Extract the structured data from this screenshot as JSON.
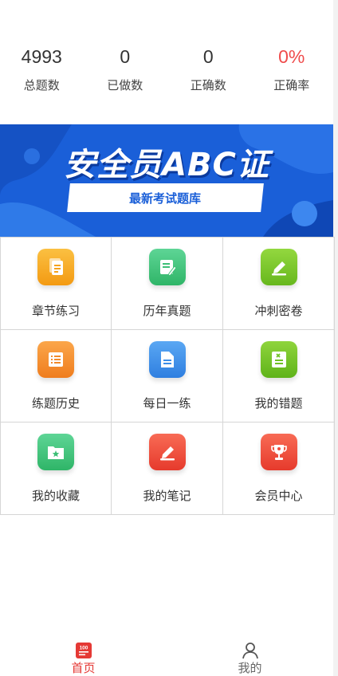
{
  "stats": [
    {
      "value": "4993",
      "label": "总题数"
    },
    {
      "value": "0",
      "label": "已做数"
    },
    {
      "value": "0",
      "label": "正确数"
    },
    {
      "value": "0%",
      "label": "正确率"
    }
  ],
  "banner": {
    "title": "安全员ABC证",
    "subtitle": "最新考试题库"
  },
  "menu": [
    {
      "label": "章节练习",
      "icon": "chapter-practice-icon",
      "color": "#f7a31c"
    },
    {
      "label": "历年真题",
      "icon": "past-exams-icon",
      "color": "#3fc07a"
    },
    {
      "label": "冲刺密卷",
      "icon": "sprint-paper-icon",
      "color": "#7cc52a"
    },
    {
      "label": "练题历史",
      "icon": "history-icon",
      "color": "#f58c2b"
    },
    {
      "label": "每日一练",
      "icon": "daily-practice-icon",
      "color": "#3b8de8"
    },
    {
      "label": "我的错题",
      "icon": "wrong-questions-icon",
      "color": "#6fc224"
    },
    {
      "label": "我的收藏",
      "icon": "favorites-icon",
      "color": "#3fbf76"
    },
    {
      "label": "我的笔记",
      "icon": "notes-icon",
      "color": "#ef4a3a"
    },
    {
      "label": "会员中心",
      "icon": "vip-center-icon",
      "color": "#ef4a3a"
    }
  ],
  "tabbar": {
    "home": {
      "label": "首页",
      "badge": "100"
    },
    "mine": {
      "label": "我的"
    }
  },
  "colors": {
    "accent_red": "#e53935",
    "banner_blue": "#1a5fd8"
  }
}
